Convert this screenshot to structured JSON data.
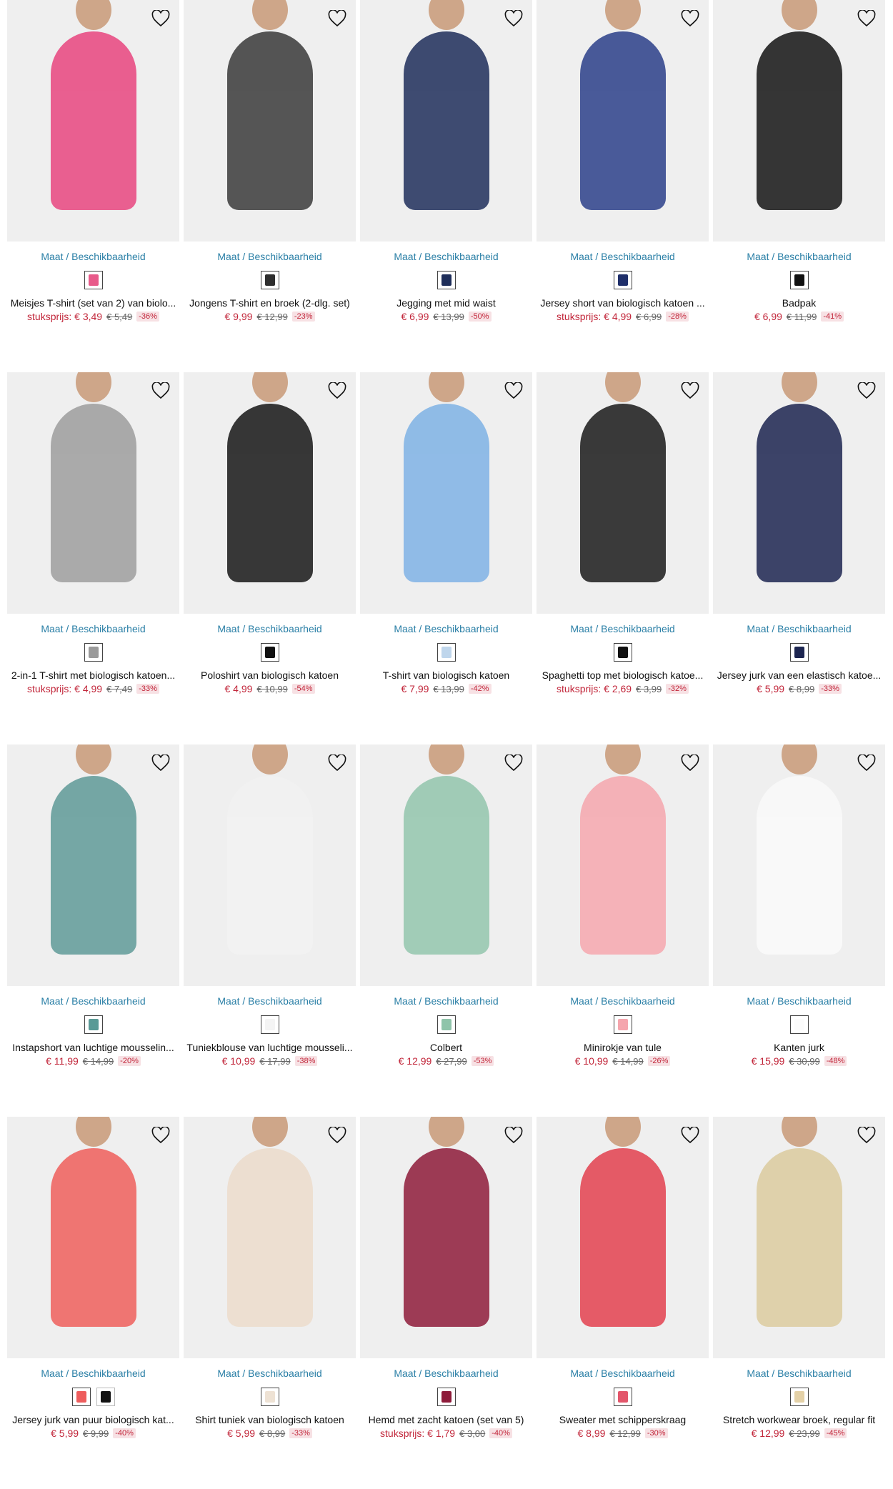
{
  "common": {
    "availability_label": "Maat / Beschikbaarheid",
    "wishlist_icon": "heart-outline-icon"
  },
  "products": [
    {
      "name": "Meisjes T-shirt (set van 2) van biolo...",
      "price": "stuksprijs: € 3,49",
      "old": "€ 5,49",
      "discount": "-36%",
      "swatches": [
        {
          "color": "#e85a8a",
          "selected": true
        }
      ],
      "img": "#e8457f"
    },
    {
      "name": "Jongens T-shirt en broek (2-dlg. set)",
      "price": "€ 9,99",
      "old": "€ 12,99",
      "discount": "-23%",
      "swatches": [
        {
          "color": "#2e2e2e",
          "selected": true
        }
      ],
      "img": "#3a3a3a"
    },
    {
      "name": "Jegging met mid waist",
      "price": "€ 6,99",
      "old": "€ 13,99",
      "discount": "-50%",
      "swatches": [
        {
          "color": "#1e2e5a",
          "selected": true
        }
      ],
      "img": "#1e2e5a"
    },
    {
      "name": "Jersey short van biologisch katoen ...",
      "price": "stuksprijs: € 4,99",
      "old": "€ 6,99",
      "discount": "-28%",
      "swatches": [
        {
          "color": "#1f2f6a",
          "selected": true
        }
      ],
      "img": "#2b3f8a"
    },
    {
      "name": "Badpak",
      "price": "€ 6,99",
      "old": "€ 11,99",
      "discount": "-41%",
      "swatches": [
        {
          "color": "#111111",
          "selected": true
        }
      ],
      "img": "#141414"
    },
    {
      "name": "2-in-1 T-shirt met biologisch katoen...",
      "price": "stuksprijs: € 4,99",
      "old": "€ 7,49",
      "discount": "-33%",
      "swatches": [
        {
          "color": "#9a9a9a",
          "selected": true
        }
      ],
      "img": "#9d9d9d"
    },
    {
      "name": "Poloshirt van biologisch katoen",
      "price": "€ 4,99",
      "old": "€ 10,99",
      "discount": "-54%",
      "swatches": [
        {
          "color": "#111111",
          "selected": true
        }
      ],
      "img": "#161616"
    },
    {
      "name": "T-shirt van biologisch katoen",
      "price": "€ 7,99",
      "old": "€ 13,99",
      "discount": "-42%",
      "swatches": [
        {
          "color": "#bfd6ec",
          "selected": true
        }
      ],
      "img": "#7fb2e5"
    },
    {
      "name": "Spaghetti top met biologisch katoe...",
      "price": "stuksprijs: € 2,69",
      "old": "€ 3,99",
      "discount": "-32%",
      "swatches": [
        {
          "color": "#111111",
          "selected": true
        }
      ],
      "img": "#1a1a1a"
    },
    {
      "name": "Jersey jurk van een elastisch katoe...",
      "price": "€ 5,99",
      "old": "€ 8,99",
      "discount": "-33%",
      "swatches": [
        {
          "color": "#1c2550",
          "selected": true
        }
      ],
      "img": "#1c2550"
    },
    {
      "name": "Instapshort van luchtige mousselin...",
      "price": "€ 11,99",
      "old": "€ 14,99",
      "discount": "-20%",
      "swatches": [
        {
          "color": "#5a9a96",
          "selected": true
        }
      ],
      "img": "#5f9a98"
    },
    {
      "name": "Tuniekblouse van luchtige mousseli...",
      "price": "€ 10,99",
      "old": "€ 17,99",
      "discount": "-38%",
      "swatches": [
        {
          "color": "#f4f4f4",
          "selected": true
        }
      ],
      "img": "#f2f2f2"
    },
    {
      "name": "Colbert",
      "price": "€ 12,99",
      "old": "€ 27,99",
      "discount": "-53%",
      "swatches": [
        {
          "color": "#8fc4aa",
          "selected": true
        }
      ],
      "img": "#93c5ad"
    },
    {
      "name": "Minirokje van tule",
      "price": "€ 10,99",
      "old": "€ 14,99",
      "discount": "-26%",
      "swatches": [
        {
          "color": "#f5a5ad",
          "selected": true
        }
      ],
      "img": "#f6a7ae"
    },
    {
      "name": "Kanten jurk",
      "price": "€ 15,99",
      "old": "€ 30,99",
      "discount": "-48%",
      "swatches": [
        {
          "color": "#fbfbfb",
          "selected": true
        }
      ],
      "img": "#fafafa"
    },
    {
      "name": "Jersey jurk van puur biologisch kat...",
      "price": "€ 5,99",
      "old": "€ 9,99",
      "discount": "-40%",
      "swatches": [
        {
          "color": "#ee5d5d",
          "selected": true
        },
        {
          "color": "#111111",
          "selected": false
        }
      ],
      "img": "#ef5f5c"
    },
    {
      "name": "Shirt tuniek van biologisch katoen",
      "price": "€ 5,99",
      "old": "€ 8,99",
      "discount": "-33%",
      "swatches": [
        {
          "color": "#eee2d4",
          "selected": true
        }
      ],
      "img": "#ecdccb"
    },
    {
      "name": "Hemd met zacht katoen (set van 5)",
      "price": "stuksprijs: € 1,79",
      "old": "€ 3,00",
      "discount": "-40%",
      "swatches": [
        {
          "color": "#8e1b3a",
          "selected": true
        }
      ],
      "img": "#8e1b3a"
    },
    {
      "name": "Sweater met schipperskraag",
      "price": "€ 8,99",
      "old": "€ 12,99",
      "discount": "-30%",
      "swatches": [
        {
          "color": "#e3566b",
          "selected": true
        }
      ],
      "img": "#e3414f"
    },
    {
      "name": "Stretch workwear broek, regular fit",
      "price": "€ 12,99",
      "old": "€ 23,99",
      "discount": "-45%",
      "swatches": [
        {
          "color": "#e4d1a7",
          "selected": true
        }
      ],
      "img": "#dccb9f"
    }
  ]
}
